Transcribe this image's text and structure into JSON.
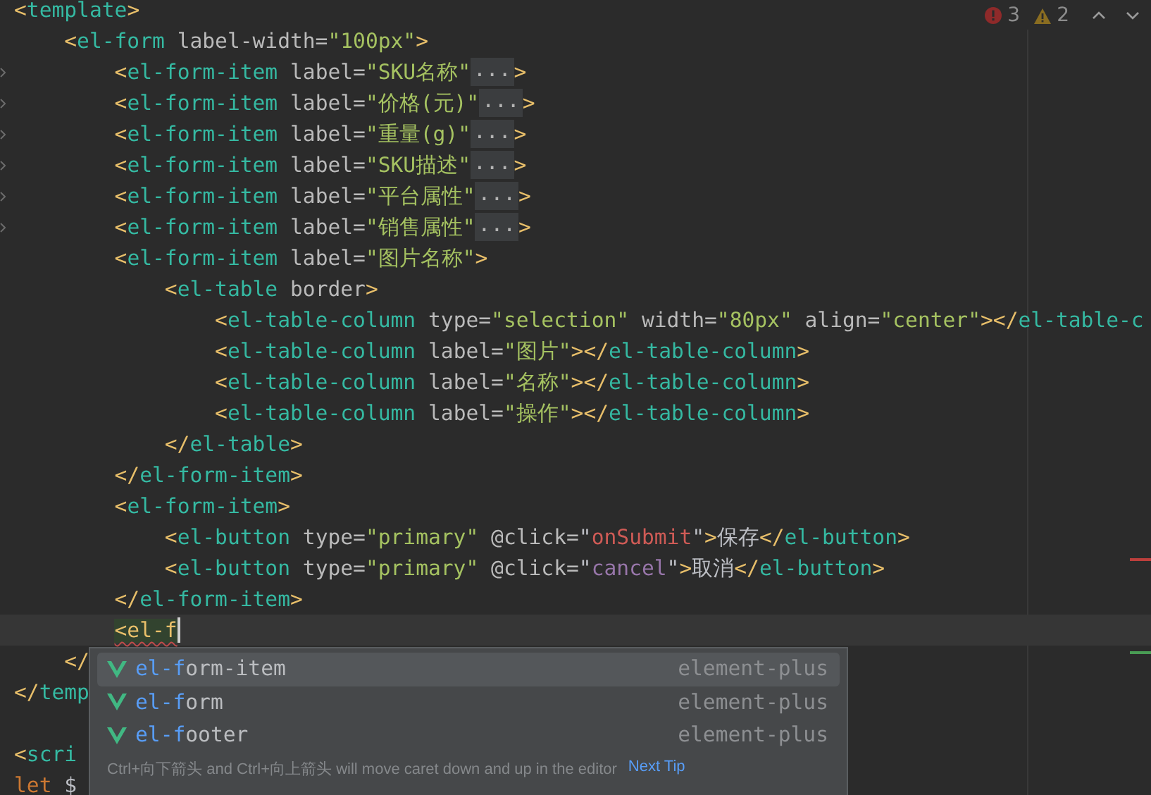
{
  "inspections": {
    "errors": "3",
    "warnings": "2"
  },
  "lines": [
    {
      "current": false,
      "tokens": [
        {
          "kind": "punct",
          "text": "<"
        },
        {
          "kind": "tag",
          "text": "template"
        },
        {
          "kind": "punct",
          "text": ">"
        }
      ],
      "children": [
        {
          "current": false,
          "tokens": [
            {
              "kind": "punct",
              "text": "<"
            },
            {
              "kind": "tag",
              "text": "el-form"
            },
            {
              "kind": "attr",
              "text": " label-width="
            },
            {
              "kind": "str",
              "text": "\"100px\""
            },
            {
              "kind": "punct",
              "text": ">"
            }
          ],
          "children": [
            {
              "current": false,
              "tokens": [
                {
                  "kind": "punct",
                  "text": "<"
                },
                {
                  "kind": "tag",
                  "text": "el-form-item"
                },
                {
                  "kind": "attr",
                  "text": " label="
                },
                {
                  "kind": "str",
                  "text": "\"SKU名称\""
                },
                {
                  "kind": "fold",
                  "text": "..."
                },
                {
                  "kind": "punct",
                  "text": ">"
                }
              ]
            },
            {
              "current": false,
              "tokens": [
                {
                  "kind": "punct",
                  "text": "<"
                },
                {
                  "kind": "tag",
                  "text": "el-form-item"
                },
                {
                  "kind": "attr",
                  "text": " label="
                },
                {
                  "kind": "str",
                  "text": "\"价格(元)\""
                },
                {
                  "kind": "fold",
                  "text": "..."
                },
                {
                  "kind": "punct",
                  "text": ">"
                }
              ]
            },
            {
              "current": false,
              "tokens": [
                {
                  "kind": "punct",
                  "text": "<"
                },
                {
                  "kind": "tag",
                  "text": "el-form-item"
                },
                {
                  "kind": "attr",
                  "text": " label="
                },
                {
                  "kind": "str",
                  "text": "\"重量(g)\""
                },
                {
                  "kind": "fold",
                  "text": "..."
                },
                {
                  "kind": "punct",
                  "text": ">"
                }
              ]
            },
            {
              "current": false,
              "tokens": [
                {
                  "kind": "punct",
                  "text": "<"
                },
                {
                  "kind": "tag",
                  "text": "el-form-item"
                },
                {
                  "kind": "attr",
                  "text": " label="
                },
                {
                  "kind": "str",
                  "text": "\"SKU描述\""
                },
                {
                  "kind": "fold",
                  "text": "..."
                },
                {
                  "kind": "punct",
                  "text": ">"
                }
              ]
            },
            {
              "current": false,
              "tokens": [
                {
                  "kind": "punct",
                  "text": "<"
                },
                {
                  "kind": "tag",
                  "text": "el-form-item"
                },
                {
                  "kind": "attr",
                  "text": " label="
                },
                {
                  "kind": "str",
                  "text": "\"平台属性\""
                },
                {
                  "kind": "fold",
                  "text": "..."
                },
                {
                  "kind": "punct",
                  "text": ">"
                }
              ]
            },
            {
              "current": false,
              "tokens": [
                {
                  "kind": "punct",
                  "text": "<"
                },
                {
                  "kind": "tag",
                  "text": "el-form-item"
                },
                {
                  "kind": "attr",
                  "text": " label="
                },
                {
                  "kind": "str",
                  "text": "\"销售属性\""
                },
                {
                  "kind": "fold",
                  "text": "..."
                },
                {
                  "kind": "punct",
                  "text": ">"
                }
              ]
            },
            {
              "current": false,
              "tokens": [
                {
                  "kind": "punct",
                  "text": "<"
                },
                {
                  "kind": "tag",
                  "text": "el-form-item"
                },
                {
                  "kind": "attr",
                  "text": " label="
                },
                {
                  "kind": "str",
                  "text": "\"图片名称\""
                },
                {
                  "kind": "punct",
                  "text": ">"
                }
              ],
              "children": [
                {
                  "current": false,
                  "tokens": [
                    {
                      "kind": "punct",
                      "text": "<"
                    },
                    {
                      "kind": "tag",
                      "text": "el-table"
                    },
                    {
                      "kind": "attr",
                      "text": " border"
                    },
                    {
                      "kind": "punct",
                      "text": ">"
                    }
                  ],
                  "children": [
                    {
                      "current": false,
                      "tokens": [
                        {
                          "kind": "punct",
                          "text": "<"
                        },
                        {
                          "kind": "tag",
                          "text": "el-table-column"
                        },
                        {
                          "kind": "attr",
                          "text": " type="
                        },
                        {
                          "kind": "str",
                          "text": "\"selection\""
                        },
                        {
                          "kind": "attr",
                          "text": " width="
                        },
                        {
                          "kind": "str",
                          "text": "\"80px\""
                        },
                        {
                          "kind": "attr",
                          "text": " align="
                        },
                        {
                          "kind": "str",
                          "text": "\"center\""
                        },
                        {
                          "kind": "punct",
                          "text": "></"
                        },
                        {
                          "kind": "tag",
                          "text": "el-table-c"
                        }
                      ]
                    },
                    {
                      "current": false,
                      "tokens": [
                        {
                          "kind": "punct",
                          "text": "<"
                        },
                        {
                          "kind": "tag",
                          "text": "el-table-column"
                        },
                        {
                          "kind": "attr",
                          "text": " label="
                        },
                        {
                          "kind": "str",
                          "text": "\"图片\""
                        },
                        {
                          "kind": "punct",
                          "text": "></"
                        },
                        {
                          "kind": "tag",
                          "text": "el-table-column"
                        },
                        {
                          "kind": "punct",
                          "text": ">"
                        }
                      ]
                    },
                    {
                      "current": false,
                      "tokens": [
                        {
                          "kind": "punct",
                          "text": "<"
                        },
                        {
                          "kind": "tag",
                          "text": "el-table-column"
                        },
                        {
                          "kind": "attr",
                          "text": " label="
                        },
                        {
                          "kind": "str",
                          "text": "\"名称\""
                        },
                        {
                          "kind": "punct",
                          "text": "></"
                        },
                        {
                          "kind": "tag",
                          "text": "el-table-column"
                        },
                        {
                          "kind": "punct",
                          "text": ">"
                        }
                      ]
                    },
                    {
                      "current": false,
                      "tokens": [
                        {
                          "kind": "punct",
                          "text": "<"
                        },
                        {
                          "kind": "tag",
                          "text": "el-table-column"
                        },
                        {
                          "kind": "attr",
                          "text": " label="
                        },
                        {
                          "kind": "str",
                          "text": "\"操作\""
                        },
                        {
                          "kind": "punct",
                          "text": "></"
                        },
                        {
                          "kind": "tag",
                          "text": "el-table-column"
                        },
                        {
                          "kind": "punct",
                          "text": ">"
                        }
                      ]
                    }
                  ]
                },
                {
                  "current": false,
                  "tokens": [
                    {
                      "kind": "punct",
                      "text": "</"
                    },
                    {
                      "kind": "tag",
                      "text": "el-table"
                    },
                    {
                      "kind": "punct",
                      "text": ">"
                    }
                  ]
                }
              ]
            },
            {
              "current": false,
              "tokens": [
                {
                  "kind": "punct",
                  "text": "</"
                },
                {
                  "kind": "tag",
                  "text": "el-form-item"
                },
                {
                  "kind": "punct",
                  "text": ">"
                }
              ]
            },
            {
              "current": false,
              "tokens": [
                {
                  "kind": "punct",
                  "text": "<"
                },
                {
                  "kind": "tag",
                  "text": "el-form-item"
                },
                {
                  "kind": "punct",
                  "text": ">"
                }
              ],
              "children": [
                {
                  "current": false,
                  "tokens": [
                    {
                      "kind": "punct",
                      "text": "<"
                    },
                    {
                      "kind": "tag",
                      "text": "el-button"
                    },
                    {
                      "kind": "attr",
                      "text": " type="
                    },
                    {
                      "kind": "str",
                      "text": "\"primary\""
                    },
                    {
                      "kind": "attr",
                      "text": " @click="
                    },
                    {
                      "kind": "text",
                      "text": "\""
                    },
                    {
                      "kind": "call",
                      "text": "onSubmit"
                    },
                    {
                      "kind": "text",
                      "text": "\""
                    },
                    {
                      "kind": "punct",
                      "text": ">"
                    },
                    {
                      "kind": "text",
                      "text": "保存"
                    },
                    {
                      "kind": "punct",
                      "text": "</"
                    },
                    {
                      "kind": "tag",
                      "text": "el-button"
                    },
                    {
                      "kind": "punct",
                      "text": ">"
                    }
                  ]
                },
                {
                  "current": false,
                  "tokens": [
                    {
                      "kind": "punct",
                      "text": "<"
                    },
                    {
                      "kind": "tag",
                      "text": "el-button"
                    },
                    {
                      "kind": "attr",
                      "text": " type="
                    },
                    {
                      "kind": "str",
                      "text": "\"primary\""
                    },
                    {
                      "kind": "attr",
                      "text": " @click="
                    },
                    {
                      "kind": "text",
                      "text": "\""
                    },
                    {
                      "kind": "var",
                      "text": "cancel"
                    },
                    {
                      "kind": "text",
                      "text": "\""
                    },
                    {
                      "kind": "punct",
                      "text": ">"
                    },
                    {
                      "kind": "text",
                      "text": "取消"
                    },
                    {
                      "kind": "punct",
                      "text": "</"
                    },
                    {
                      "kind": "tag",
                      "text": "el-button"
                    },
                    {
                      "kind": "punct",
                      "text": ">"
                    }
                  ]
                }
              ]
            },
            {
              "current": false,
              "tokens": [
                {
                  "kind": "punct",
                  "text": "</"
                },
                {
                  "kind": "tag",
                  "text": "el-form-item"
                },
                {
                  "kind": "punct",
                  "text": ">"
                }
              ]
            },
            {
              "current": true,
              "tokens": [
                {
                  "kind": "typed",
                  "text": "<el-f"
                }
              ]
            }
          ]
        },
        {
          "current": false,
          "tokens": [
            {
              "kind": "punct",
              "text": "</"
            }
          ]
        }
      ]
    },
    {
      "tokens": [
        {
          "kind": "punct",
          "text": "</"
        },
        {
          "kind": "tag",
          "text": "temp"
        }
      ]
    },
    {
      "current": false
    },
    {
      "current": false,
      "tokens": [
        {
          "kind": "punct",
          "text": "<"
        },
        {
          "kind": "tag",
          "text": "scri"
        }
      ]
    },
    {
      "current": false,
      "tokens": [
        {
          "kind": "keyword",
          "text": "let"
        },
        {
          "kind": "text",
          "text": " $"
        }
      ]
    }
  ],
  "completion": {
    "items": [
      {
        "typed": "el-f",
        "rest": "orm-item",
        "source": "element-plus",
        "selected": true
      },
      {
        "typed": "el-f",
        "rest": "orm",
        "source": "element-plus",
        "selected": false
      },
      {
        "typed": "el-f",
        "rest": "ooter",
        "source": "element-plus",
        "selected": false
      }
    ],
    "tip": "Ctrl+向下箭头 and Ctrl+向上箭头 will move caret down and up in the editor",
    "tip_link": "Next Tip"
  }
}
